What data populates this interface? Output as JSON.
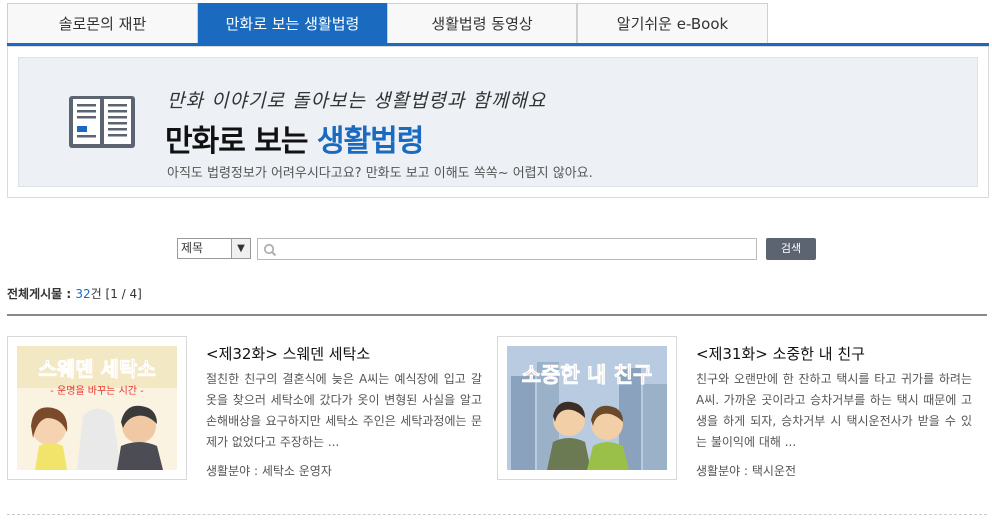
{
  "tabs": [
    {
      "label": "솔로몬의 재판",
      "active": false
    },
    {
      "label": "만화로 보는 생활법령",
      "active": true
    },
    {
      "label": "생활법령 동영상",
      "active": false
    },
    {
      "label": "알기쉬운 e-Book",
      "active": false
    }
  ],
  "banner": {
    "subtitle": "만화 이야기로 돌아보는 생활법령과 함께해요",
    "title_main": "만화로 보는 ",
    "title_highlight": "생활법령",
    "description": "아직도 법령정보가 어려우시다고요? 만화도 보고 이해도 쏙쏙~ 어렵지 않아요."
  },
  "search": {
    "select_value": "제목",
    "input_value": "",
    "button_label": "검색"
  },
  "count": {
    "label": "전체게시물 : ",
    "total": "32",
    "unit": "건",
    "page": "[1 / 4]"
  },
  "items": [
    {
      "title": "<제32화> 스웨덴 세탁소",
      "description": "절친한 친구의 결혼식에 늦은 A씨는 예식장에 입고 갈 옷을 찾으러 세탁소에 갔다가 옷이 변형된 사실을 알고 손해배상을 요구하지만 세탁소 주인은 세탁과정에는 문제가 없었다고 주장하는 ...",
      "meta": "생활분야 : 세탁소 운영자",
      "thumb_title": "스웨덴 세탁소",
      "thumb_sub": "- 운명을 바꾸는 시간 -"
    },
    {
      "title": "<제31화> 소중한 내 친구",
      "description": "친구와 오랜만에 한 잔하고 택시를 타고 귀가를 하려는 A씨. 가까운 곳이라고 승차거부를 하는 택시 때문에 고생을 하게 되자, 승차거부 시 택시운전사가 받을 수 있는 불이익에 대해 ...",
      "meta": "생활분야 : 택시운전",
      "thumb_title": "소중한 내 친구"
    }
  ],
  "colors": {
    "accent": "#1a6bbf",
    "banner_bg": "#edf1f6",
    "button_bg": "#5b6470"
  }
}
